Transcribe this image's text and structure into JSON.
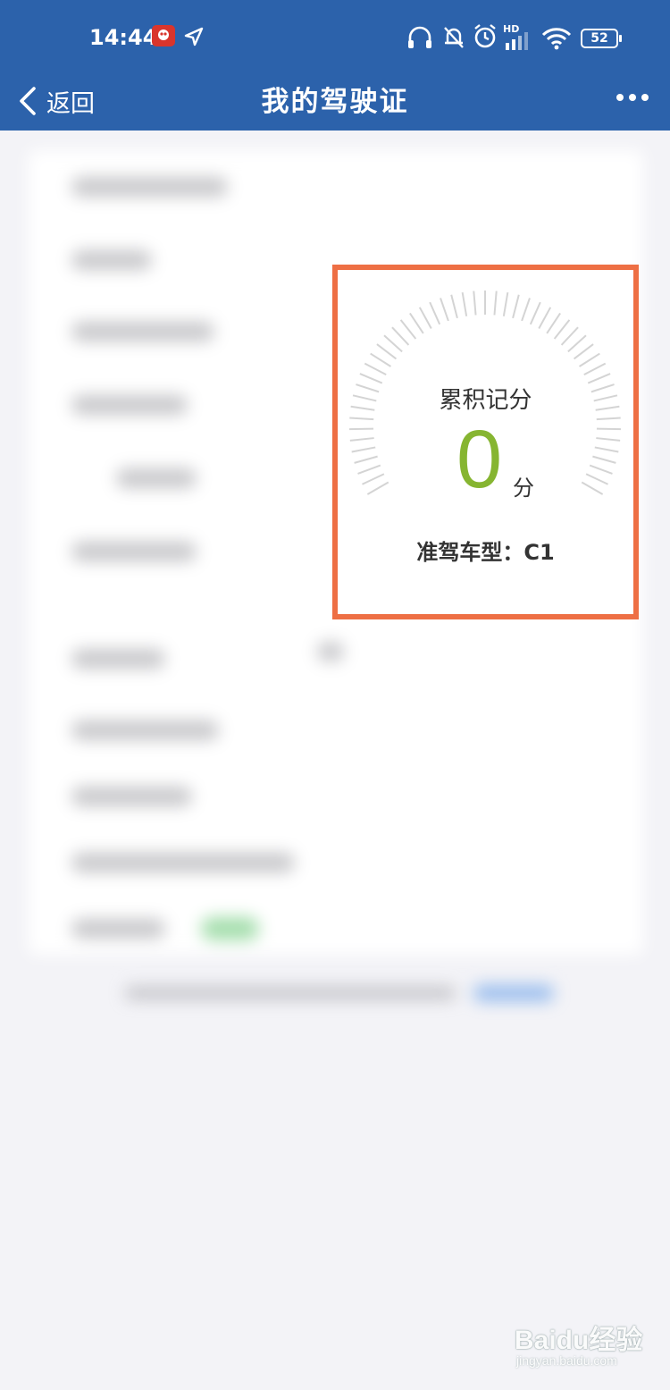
{
  "status_bar": {
    "time": "14:44",
    "battery": "52",
    "network_badge": "HD",
    "icons": [
      "app-notification-icon",
      "location-arrow-icon",
      "headphones-icon",
      "bell-muted-icon",
      "alarm-icon",
      "signal-icon",
      "wifi-icon",
      "battery-icon"
    ]
  },
  "nav": {
    "back_label": "返回",
    "title": "我的驾驶证",
    "more_icon": "more-dots-icon"
  },
  "points_card": {
    "label": "累积记分",
    "value": "0",
    "unit": "分",
    "class_label": "准驾车型：C1",
    "highlight_color": "#ee6f44",
    "value_color": "#86b531"
  },
  "colors": {
    "header": "#2c62ab",
    "background": "#f3f3f7"
  },
  "watermark": {
    "main": "Baidu经验",
    "sub": "jingyan.baidu.com"
  }
}
